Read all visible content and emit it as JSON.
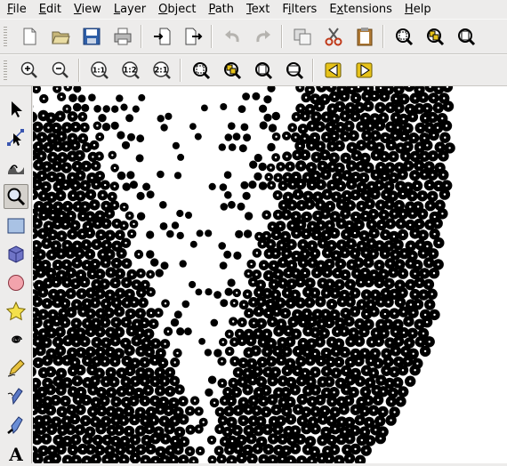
{
  "menubar": {
    "items": [
      {
        "label": "File",
        "mnemonic": "F",
        "rest": "ile"
      },
      {
        "label": "Edit",
        "mnemonic": "E",
        "rest": "dit"
      },
      {
        "label": "View",
        "mnemonic": "V",
        "rest": "iew"
      },
      {
        "label": "Layer",
        "mnemonic": "L",
        "rest": "ayer"
      },
      {
        "label": "Object",
        "mnemonic": "O",
        "rest": "bject"
      },
      {
        "label": "Path",
        "mnemonic": "P",
        "rest": "ath"
      },
      {
        "label": "Text",
        "mnemonic": "T",
        "rest": "ext"
      },
      {
        "label": "Filters",
        "mnemonic": "i",
        "pre": "F",
        "rest": "lters"
      },
      {
        "label": "Extensions",
        "mnemonic": "x",
        "pre": "E",
        "rest": "tensions"
      },
      {
        "label": "Help",
        "mnemonic": "H",
        "rest": "elp"
      }
    ]
  },
  "commands_bar": {
    "buttons": [
      "new-document-icon",
      "open-folder-icon",
      "save-icon",
      "print-icon",
      "import-icon",
      "export-icon",
      "undo-icon",
      "redo-icon",
      "duplicate-icon",
      "cut-icon",
      "paste-icon",
      "zoom-selection-icon",
      "zoom-drawing-icon",
      "zoom-page-icon"
    ]
  },
  "zoom_bar": {
    "labels": {
      "one_to_one": "1:1",
      "one_to_two": "1:2",
      "two_to_one": "2:1"
    }
  },
  "toolbox": {
    "tools": [
      "selector-tool-icon",
      "node-tool-icon",
      "tweak-tool-icon",
      "zoom-tool-icon",
      "rectangle-tool-icon",
      "box3d-tool-icon",
      "ellipse-tool-icon",
      "star-tool-icon",
      "spiral-tool-icon",
      "pencil-tool-icon",
      "pen-tool-icon",
      "calligraphy-tool-icon",
      "text-tool-icon"
    ],
    "active": "zoom-tool-icon",
    "text_tool_glyph": "A"
  },
  "colors": {
    "chrome": "#edeceb",
    "dot": "#000000",
    "canvas": "#ffffff",
    "save_blue": "#2f5fa8",
    "nav_gold": "#e6c21a"
  }
}
